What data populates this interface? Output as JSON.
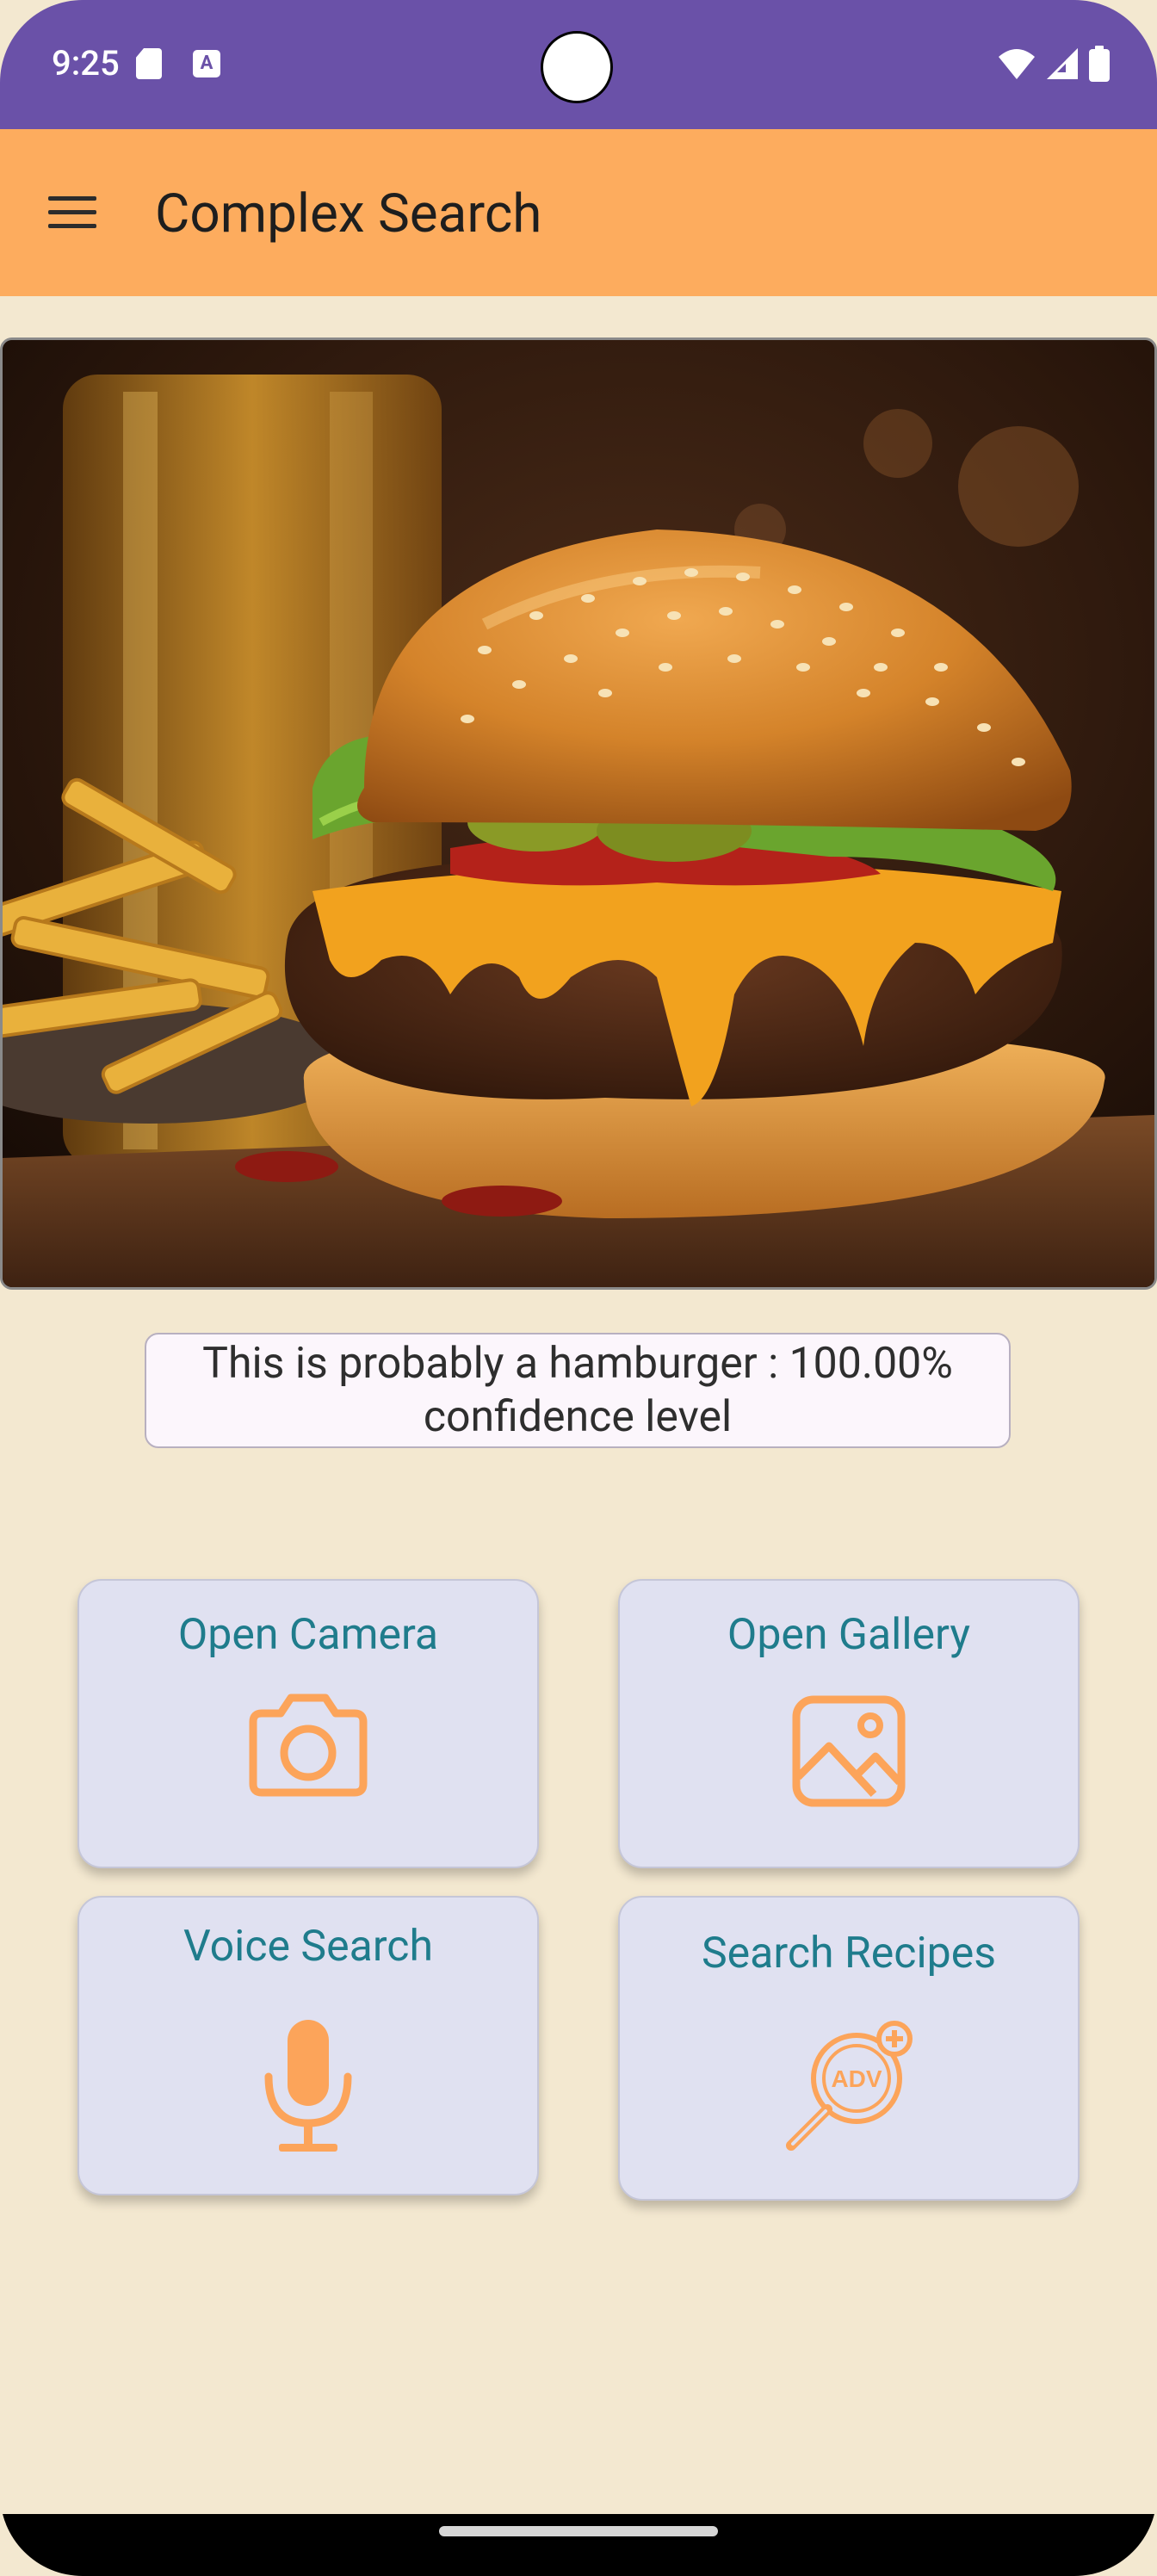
{
  "status_bar": {
    "time": "9:25",
    "background": "#6A51A8"
  },
  "app_bar": {
    "title": "Complex Search",
    "background": "#FDAC5E",
    "menu_icon": "hamburger-menu-icon"
  },
  "result": {
    "text": "This is probably a hamburger : 100.00% confidence level"
  },
  "actions": [
    {
      "label": "Open Camera",
      "icon": "camera-icon"
    },
    {
      "label": "Open Gallery",
      "icon": "image-icon"
    },
    {
      "label": "Voice Search",
      "icon": "microphone-icon"
    },
    {
      "label": "Search Recipes",
      "icon": "advanced-search-icon",
      "icon_text": "ADV"
    }
  ],
  "colors": {
    "page_background": "#F3E8D0",
    "card_background": "#E0E1F1",
    "card_label": "#1F7C8C",
    "icon": "#FCA45A"
  }
}
